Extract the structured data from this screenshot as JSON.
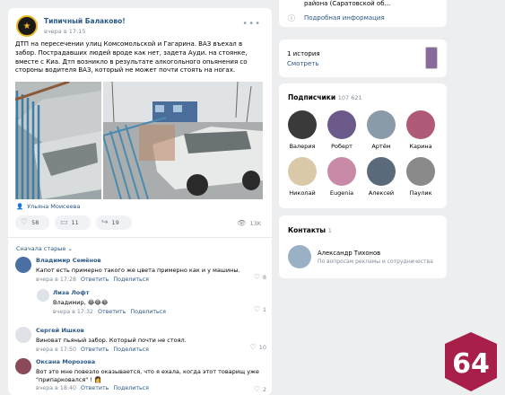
{
  "post": {
    "group_name": "Типичный Балаково!",
    "time": "вчера в 17:15",
    "text": "ДТП на пересечении улиц Комсомольской и Гагарина. ВАЗ въехал в забор. Пострадавших людей вроде как нет, задета Ауди. на стоянке, вместе с Киа. Дтп возникло в результате алкогольного опьянения со стороны водителя ВАЗ, который не может почти стоять на ногах.",
    "author": "Ульяна Моисеева",
    "likes": "58",
    "comments": "11",
    "shares": "19",
    "views": "13K"
  },
  "comments_sort": "Сначала старые",
  "comments": [
    {
      "name": "Владимир Семёнов",
      "text": "Капот есть примерно такого же цвета примерно как и у машины.",
      "time": "вчера в 17:28",
      "reply": "Ответить",
      "share": "Поделиться",
      "likes": "8",
      "color": "#4a6fa5"
    },
    {
      "name": "Лиза Лофт",
      "text": "Владимир, 😂😂😂",
      "time": "вчера в 17:32",
      "reply": "Ответить",
      "share": "Поделиться",
      "likes": "1",
      "color": "#dfe3e8"
    },
    {
      "name": "Сергей Ишков",
      "text": "Виноват пьяный забор. Который почти не стоял.",
      "time": "вчера в 17:50",
      "reply": "Ответить",
      "share": "Поделиться",
      "likes": "10",
      "color": "#dfe3e8"
    },
    {
      "name": "Оксана Морозова",
      "text": "Вот это мне повезло оказывается, что я ехала, когда этот товарищ уже \"припарковался\" ! 👩",
      "time": "вчера в 18:40",
      "reply": "Ответить",
      "share": "Поделиться",
      "likes": "2",
      "color": "#8b4a5a"
    }
  ],
  "sidebar": {
    "info_top": "района (Саратовской об...",
    "info_link": "Подробная информация",
    "stories_count": "1 история",
    "stories_link": "Смотреть",
    "subs_title": "Подписчики",
    "subs_count": "107 621",
    "subscribers": [
      {
        "name": "Валерия",
        "color": "#3a3a3a"
      },
      {
        "name": "Роберт",
        "color": "#6b5a8a"
      },
      {
        "name": "Артём",
        "color": "#8a9aa8"
      },
      {
        "name": "Карина",
        "color": "#b05a7a"
      },
      {
        "name": "Николай",
        "color": "#d9c9a8"
      },
      {
        "name": "Eugenia",
        "color": "#c98aa8"
      },
      {
        "name": "Алексей",
        "color": "#5a6a7a"
      },
      {
        "name": "Паулик",
        "color": "#8a8a8a"
      }
    ],
    "contacts_title": "Контакты",
    "contacts_count": "1",
    "contact_name": "Александр Тихонов",
    "contact_role": "По вопросам рекламы и сотрудничества"
  },
  "badge": "64"
}
